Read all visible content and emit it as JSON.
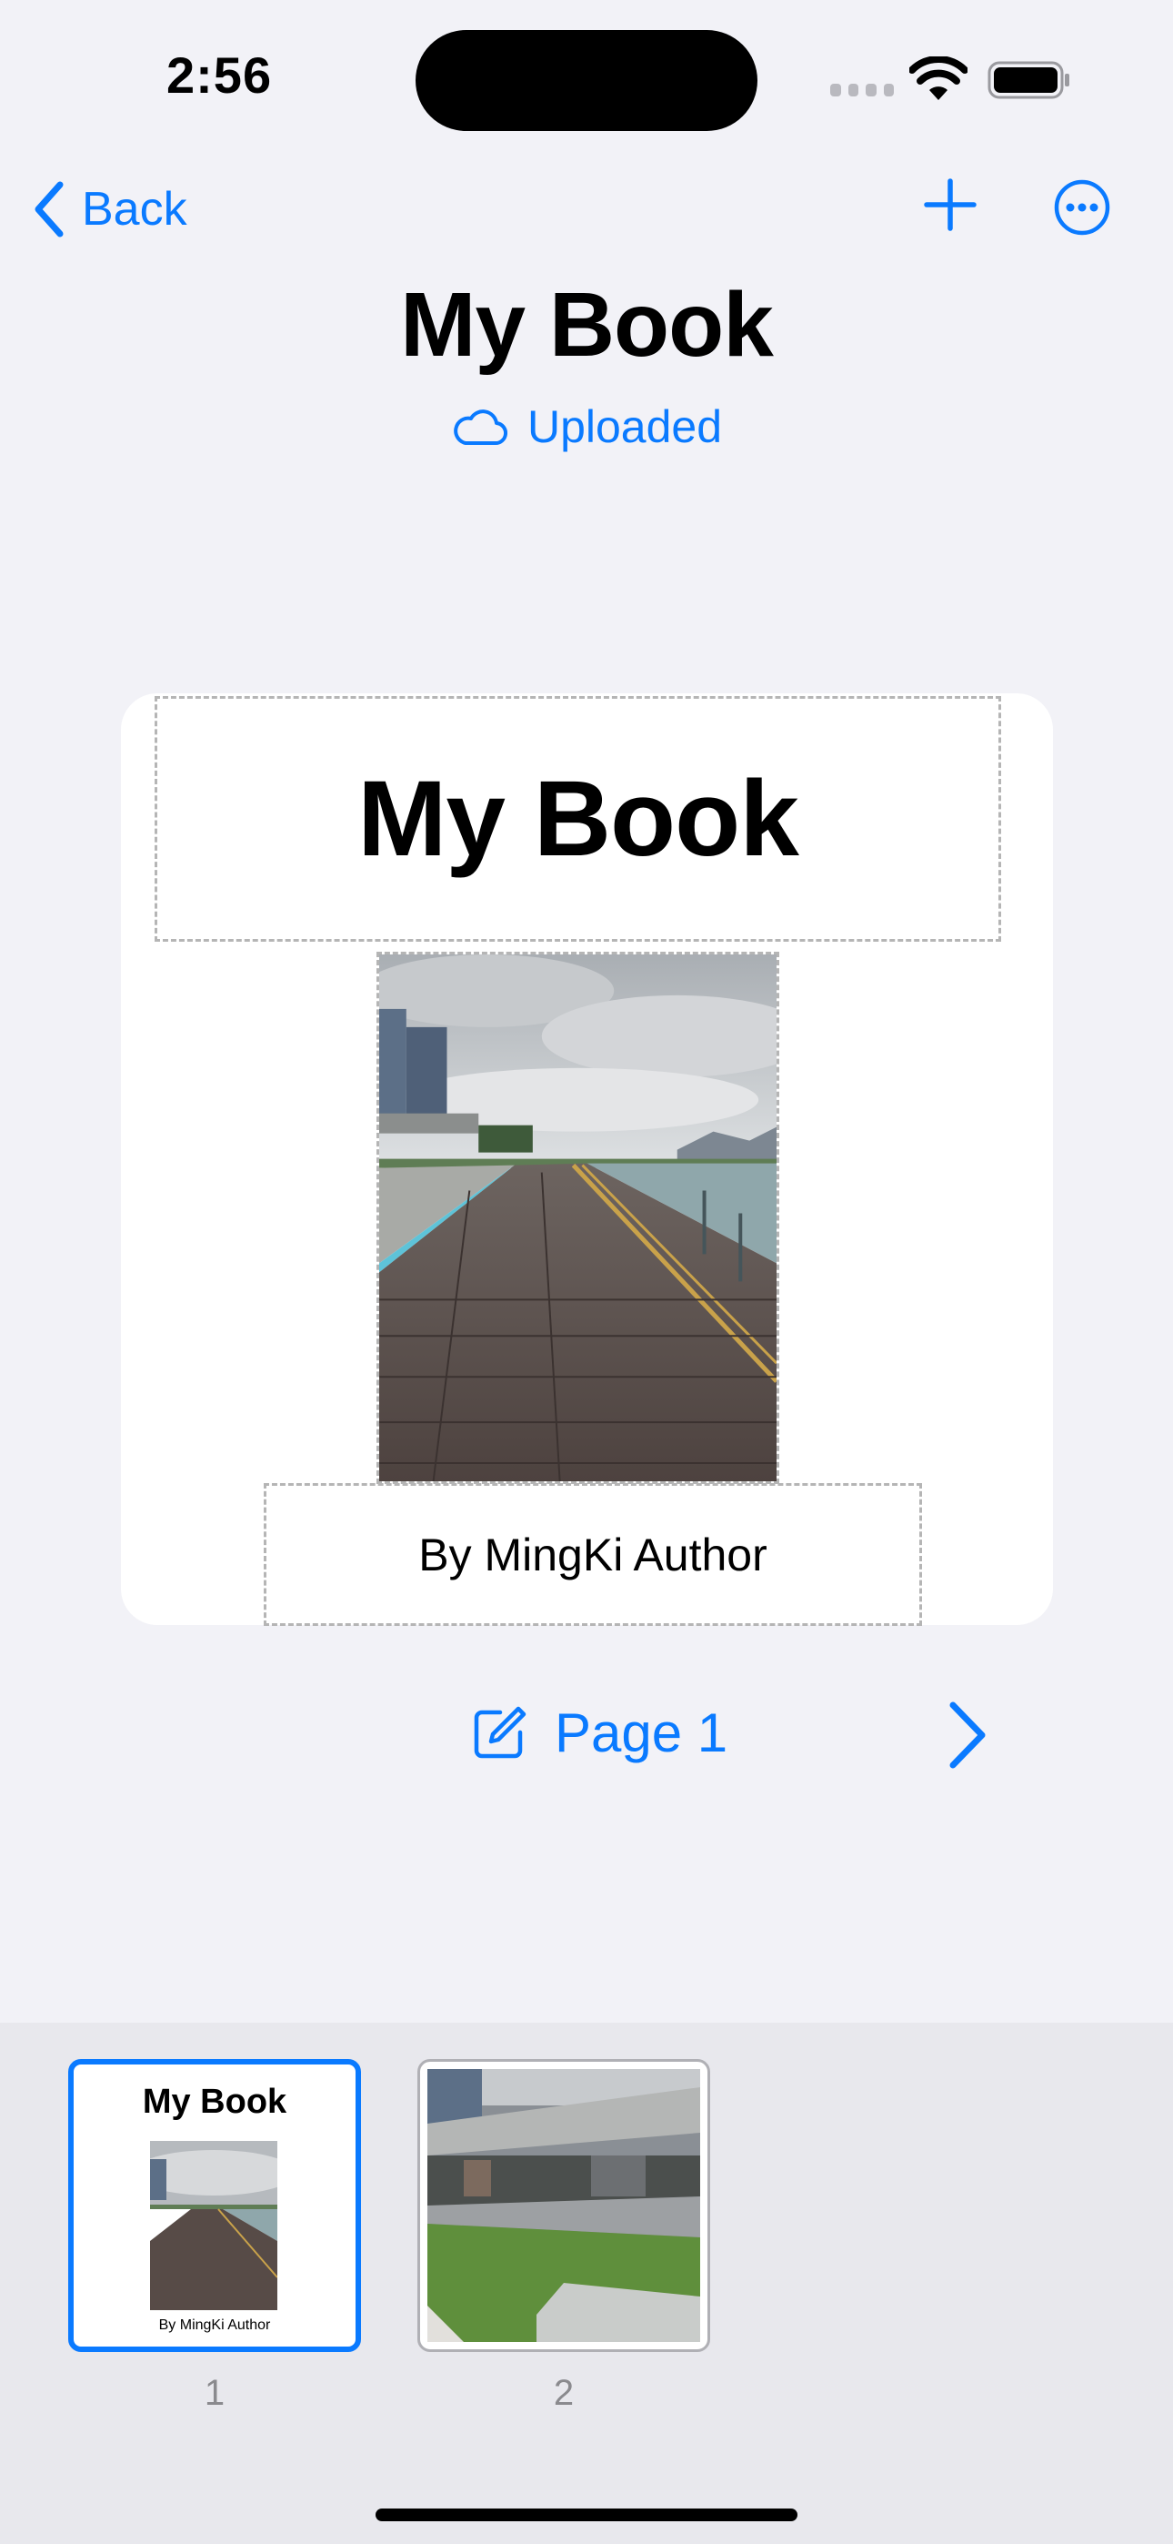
{
  "status_bar": {
    "time": "2:56"
  },
  "nav": {
    "back_label": "Back",
    "add_icon": "plus-icon",
    "more_icon": "ellipsis-circle-icon"
  },
  "header": {
    "title": "My Book",
    "sync_status": "Uploaded",
    "sync_icon": "cloud-icon"
  },
  "card": {
    "title": "My Book",
    "author": "By MingKi Author"
  },
  "page_nav": {
    "label": "Page 1",
    "edit_icon": "square-pencil-icon",
    "next_icon": "chevron-right-icon"
  },
  "thumbnails": [
    {
      "number": "1",
      "title": "My Book",
      "author": "By MingKi Author",
      "selected": true
    },
    {
      "number": "2",
      "selected": false
    }
  ],
  "colors": {
    "accent": "#0a7aff",
    "background": "#f2f2f7",
    "tray": "#e8e8ed"
  }
}
